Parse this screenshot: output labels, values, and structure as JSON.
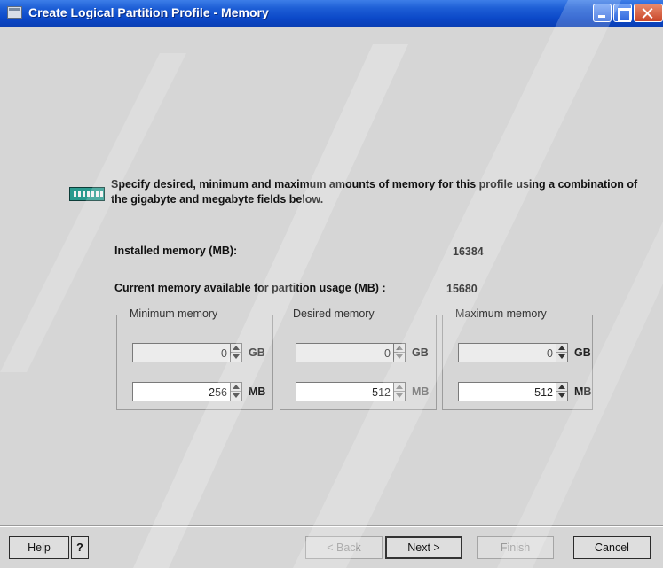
{
  "window": {
    "title": "Create Logical Partition Profile - Memory"
  },
  "intro": {
    "icon": "memory-module-icon",
    "text": "Specify desired, minimum and maximum amounts of memory for this profile using a combination of the gigabyte and megabyte fields below."
  },
  "info": {
    "installed_label": "Installed memory (MB):",
    "installed_value": "16384",
    "available_label": "Current memory available for partition usage (MB) :",
    "available_value": "15680"
  },
  "groups": [
    {
      "legend": "Minimum memory",
      "gb_value": "0",
      "gb_unit": "GB",
      "mb_value": "256",
      "mb_unit": "MB"
    },
    {
      "legend": "Desired memory",
      "gb_value": "0",
      "gb_unit": "GB",
      "mb_value": "512",
      "mb_unit": "MB"
    },
    {
      "legend": "Maximum memory",
      "gb_value": "0",
      "gb_unit": "GB",
      "mb_value": "512",
      "mb_unit": "MB"
    }
  ],
  "buttons": {
    "help": "Help",
    "question": "?",
    "back": "< Back",
    "next": "Next >",
    "finish": "Finish",
    "cancel": "Cancel"
  },
  "colors": {
    "titlebar": "#0b48c8",
    "dialog_bg": "#d6d6d6",
    "memory_icon": "#2a9a8e"
  }
}
